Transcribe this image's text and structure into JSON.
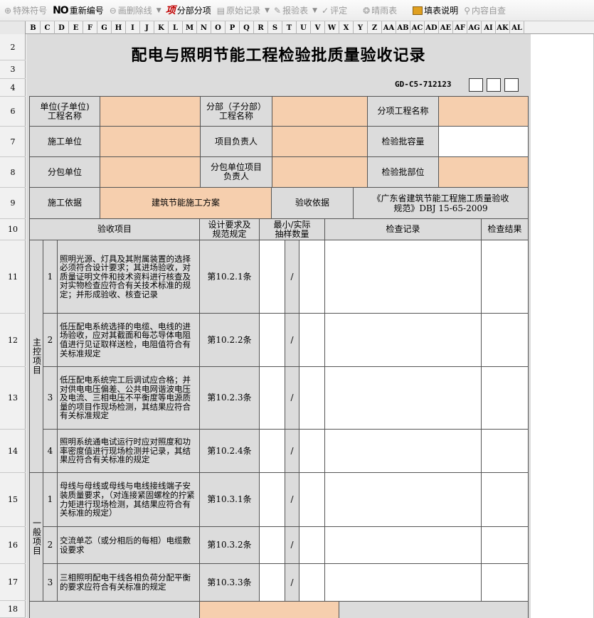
{
  "toolbar": {
    "items": [
      {
        "label": "特殊符号",
        "icon": "special-symbol-icon",
        "enabled": false
      },
      {
        "label": "重新编号",
        "icon": "renumber-icon",
        "icon_text": "NO",
        "enabled": true
      },
      {
        "label": "画删除线",
        "icon": "strikethrough-icon",
        "enabled": false
      },
      {
        "label": "分部分项",
        "icon": "sub-project-icon",
        "icon_text": "项",
        "enabled": true
      },
      {
        "label": "原始记录",
        "icon": "original-record-icon",
        "enabled": false
      },
      {
        "label": "报验表",
        "icon": "inspection-form-icon",
        "enabled": false
      },
      {
        "label": "评定",
        "icon": "evaluate-icon",
        "enabled": false
      },
      {
        "label": "晴雨表",
        "icon": "weather-icon",
        "enabled": false
      },
      {
        "label": "填表说明",
        "icon": "form-guide-icon",
        "enabled": true
      },
      {
        "label": "内容自查",
        "icon": "self-check-icon",
        "enabled": false
      }
    ]
  },
  "columns": [
    "B",
    "C",
    "D",
    "E",
    "F",
    "G",
    "H",
    "I",
    "J",
    "K",
    "L",
    "M",
    "N",
    "O",
    "P",
    "Q",
    "R",
    "S",
    "T",
    "U",
    "V",
    "W",
    "X",
    "Y",
    "Z",
    "AA",
    "AB",
    "AC",
    "AD",
    "AE",
    "AF",
    "AG",
    "AI",
    "AK",
    "AL"
  ],
  "rows": [
    "2",
    "3",
    "4",
    "6",
    "7",
    "8",
    "9",
    "10",
    "11",
    "12",
    "13",
    "14",
    "15",
    "16",
    "17",
    "18"
  ],
  "form": {
    "title": "配电与照明节能工程检验批质量验收记录",
    "code": "GD-C5-712123",
    "unit_project_label": "单位(子单位)\n工程名称",
    "sub_project_label": "分部（子分部）\n工程名称",
    "item_project_label": "分项工程名称",
    "construction_unit_label": "施工单位",
    "project_leader_label": "项目负责人",
    "batch_capacity_label": "检验批容量",
    "subcontract_unit_label": "分包单位",
    "subcontract_leader_label": "分包单位项目\n负责人",
    "batch_location_label": "检验批部位",
    "construction_basis_label": "施工依据",
    "construction_basis_value": "建筑节能施工方案",
    "acceptance_basis_label": "验收依据",
    "acceptance_basis_value": "《广东省建筑节能工程施工质量验收\n规范》DBJ 15-65-2009",
    "header_items": "验收项目",
    "header_design": "设计要求及\n规范规定",
    "header_sample": "最小/实际\n抽样数量",
    "header_record": "检查记录",
    "header_result": "检查结果",
    "group_main": "主控项目",
    "group_general": "一般项目",
    "slash": "/",
    "items": [
      {
        "no": "1",
        "text": "照明光源、灯具及其附属装置的选择必须符合设计要求；其进场验收，对质量证明文件和技术资料进行核查及对实物检查应符合有关技术标准的规定；并形成验收、核查记录",
        "clause": "第10.2.1条"
      },
      {
        "no": "2",
        "text": "低压配电系统选择的电缆、电线的进场验收，应对其截面和每芯导体电阻值进行见证取样送检，电阻值符合有关标准规定",
        "clause": "第10.2.2条"
      },
      {
        "no": "3",
        "text": "低压配电系统完工后调试应合格；并对供电电压偏差、公共电网谐波电压及电流、三相电压不平衡度等电源质量的项目作现场检测，其结果应符合有关标准规定",
        "clause": "第10.2.3条"
      },
      {
        "no": "4",
        "text": "照明系统通电试运行时应对照度和功率密度值进行现场检测并记录，其结果应符合有关标准的规定",
        "clause": "第10.2.4条"
      },
      {
        "no": "1",
        "text": "母线与母线或母线与电线接线端子安装质量要求，（对连接紧固螺栓的拧紧力矩进行现场检测，其结果应符合有关标准的规定）",
        "clause": "第10.3.1条"
      },
      {
        "no": "2",
        "text": "交流单芯（或分相后的每相）电缆敷设要求",
        "clause": "第10.3.2条"
      },
      {
        "no": "3",
        "text": "三相照明配电干线各相负荷分配平衡的要求应符合有关标准的规定",
        "clause": "第10.3.3条"
      }
    ]
  },
  "colors": {
    "peach": "#f6cfae",
    "gray": "#dcdcdc",
    "strike_red": "#c00000"
  }
}
